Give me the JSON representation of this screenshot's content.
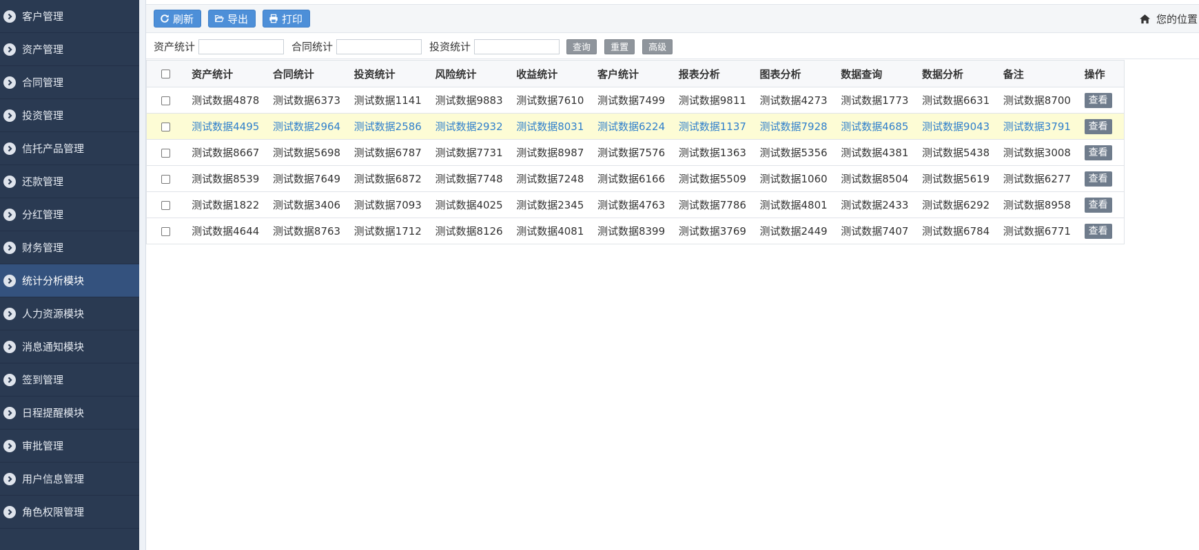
{
  "sidebar": {
    "items": [
      {
        "label": "客户管理"
      },
      {
        "label": "资产管理"
      },
      {
        "label": "合同管理"
      },
      {
        "label": "投资管理"
      },
      {
        "label": "信托产品管理"
      },
      {
        "label": "还款管理"
      },
      {
        "label": "分红管理"
      },
      {
        "label": "财务管理"
      },
      {
        "label": "统计分析模块",
        "active": true
      },
      {
        "label": "人力资源模块"
      },
      {
        "label": "消息通知模块"
      },
      {
        "label": "签到管理"
      },
      {
        "label": "日程提醒模块"
      },
      {
        "label": "审批管理"
      },
      {
        "label": "用户信息管理"
      },
      {
        "label": "角色权限管理"
      }
    ]
  },
  "toolbar": {
    "refresh_label": "刷新",
    "export_label": "导出",
    "print_label": "打印",
    "position_label": "您的位置"
  },
  "search": {
    "field1_label": "资产统计",
    "field1_value": "",
    "field2_label": "合同统计",
    "field2_value": "",
    "field3_label": "投资统计",
    "field3_value": "",
    "query_label": "查询",
    "reset_label": "重置",
    "advanced_label": "高级"
  },
  "table": {
    "headers": [
      "资产统计",
      "合同统计",
      "投资统计",
      "风险统计",
      "收益统计",
      "客户统计",
      "报表分析",
      "图表分析",
      "数据查询",
      "数据分析",
      "备注",
      "操作"
    ],
    "view_label": "查看",
    "rows": [
      {
        "cells": [
          "测试数据4878",
          "测试数据6373",
          "测试数据1141",
          "测试数据9883",
          "测试数据7610",
          "测试数据7499",
          "测试数据9811",
          "测试数据4273",
          "测试数据1773",
          "测试数据6631",
          "测试数据8700"
        ]
      },
      {
        "cells": [
          "测试数据4495",
          "测试数据2964",
          "测试数据2586",
          "测试数据2932",
          "测试数据8031",
          "测试数据6224",
          "测试数据1137",
          "测试数据7928",
          "测试数据4685",
          "测试数据9043",
          "测试数据3791"
        ],
        "highlighted": true
      },
      {
        "cells": [
          "测试数据8667",
          "测试数据5698",
          "测试数据6787",
          "测试数据7731",
          "测试数据8987",
          "测试数据7576",
          "测试数据1363",
          "测试数据5356",
          "测试数据4381",
          "测试数据5438",
          "测试数据3008"
        ]
      },
      {
        "cells": [
          "测试数据8539",
          "测试数据7649",
          "测试数据6872",
          "测试数据7748",
          "测试数据7248",
          "测试数据6166",
          "测试数据5509",
          "测试数据1060",
          "测试数据8504",
          "测试数据5619",
          "测试数据6277"
        ]
      },
      {
        "cells": [
          "测试数据1822",
          "测试数据3406",
          "测试数据7093",
          "测试数据4025",
          "测试数据2345",
          "测试数据4763",
          "测试数据7786",
          "测试数据4801",
          "测试数据2433",
          "测试数据6292",
          "测试数据8958"
        ]
      },
      {
        "cells": [
          "测试数据4644",
          "测试数据8763",
          "测试数据1712",
          "测试数据8126",
          "测试数据4081",
          "测试数据8399",
          "测试数据3769",
          "测试数据2449",
          "测试数据7407",
          "测试数据6784",
          "测试数据6771"
        ]
      }
    ]
  },
  "colors": {
    "sidebar_bg": "#2a3a52",
    "sidebar_active": "#34527e",
    "primary_button": "#4d8fd8",
    "highlight_row_bg": "#fdfcd5",
    "highlight_row_text": "#2f7fcc"
  },
  "icons": {
    "sidebar": "chevron-circle-right-icon",
    "refresh": "refresh-icon",
    "export": "folder-open-icon",
    "print": "print-icon",
    "position": "home-icon"
  }
}
